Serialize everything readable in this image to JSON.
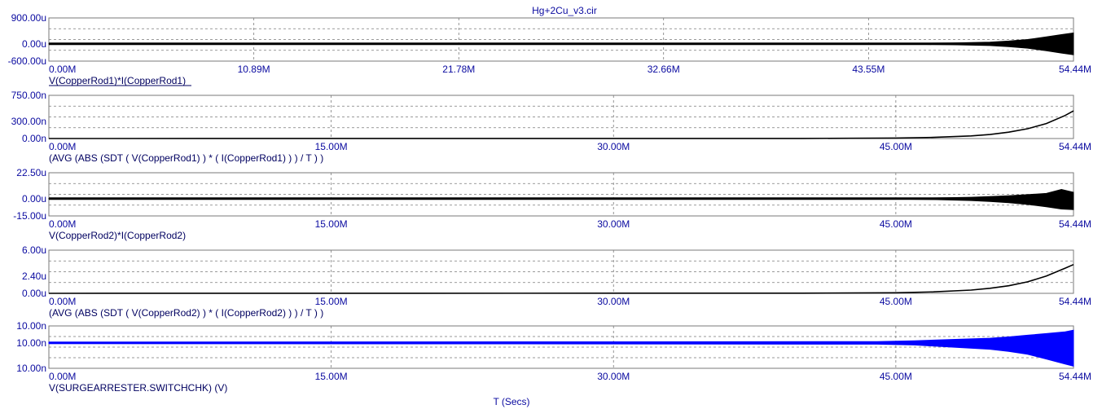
{
  "window": {
    "title": "Hg+2Cu_v3.cir"
  },
  "xaxis": {
    "label": "T (Secs)"
  },
  "colors": {
    "text": "#0a0aa0",
    "grid": "#7a7a7a",
    "frame": "#7a7a7a",
    "trace": "#000000",
    "trace_blue": "#0000ff"
  },
  "chart_data": [
    {
      "type": "line",
      "trace": "V(CopperRod1)*I(CopperRod1)",
      "xlim": [
        0,
        54.44
      ],
      "x_unit": "M",
      "xticks": [
        "0.00M",
        "10.89M",
        "21.78M",
        "32.66M",
        "43.55M",
        "54.44M"
      ],
      "ylim": [
        -600,
        900
      ],
      "y_unit": "u",
      "yticks": [
        "900.00u",
        "0.00u",
        "-600.00u"
      ],
      "ytick_values": [
        900,
        0,
        -600
      ],
      "color": "#000000",
      "series": [
        {
          "style": "oscillating-envelope",
          "x": [
            0,
            43.55,
            46,
            48,
            50,
            51,
            52,
            53,
            53.8,
            54.44
          ],
          "upper": [
            3,
            6,
            14,
            30,
            60,
            95,
            150,
            240,
            320,
            380
          ],
          "lower": [
            -3,
            -6,
            -14,
            -30,
            -60,
            -95,
            -150,
            -240,
            -320,
            -380
          ]
        }
      ]
    },
    {
      "type": "line",
      "trace": "(AVG (ABS (SDT ( V(CopperRod1) ) * ( I(CopperRod1) ) ) / T ) )",
      "xlim": [
        0,
        54.44
      ],
      "x_unit": "M",
      "xticks": [
        "0.00M",
        "15.00M",
        "30.00M",
        "45.00M",
        "54.44M"
      ],
      "ylim": [
        0,
        750
      ],
      "y_unit": "n",
      "yticks": [
        "750.00n",
        "300.00n",
        "0.00n"
      ],
      "ytick_values": [
        750,
        300,
        0
      ],
      "color": "#000000",
      "series": [
        {
          "style": "line",
          "x": [
            0,
            40,
            45,
            47,
            49,
            50,
            51,
            52,
            53,
            54,
            54.44
          ],
          "y": [
            0,
            2,
            8,
            20,
            45,
            70,
            110,
            170,
            260,
            400,
            480
          ]
        }
      ]
    },
    {
      "type": "line",
      "trace": "V(CopperRod2)*I(CopperRod2)",
      "xlim": [
        0,
        54.44
      ],
      "x_unit": "M",
      "xticks": [
        "0.00M",
        "15.00M",
        "30.00M",
        "45.00M",
        "54.44M"
      ],
      "ylim": [
        -15,
        22.5
      ],
      "y_unit": "u",
      "yticks": [
        "22.50u",
        "0.00u",
        "-15.00u"
      ],
      "ytick_values": [
        22.5,
        0,
        -15
      ],
      "color": "#000000",
      "series": [
        {
          "style": "oscillating-envelope",
          "x": [
            0,
            45,
            47,
            49,
            50,
            51,
            52,
            53,
            53.8,
            54.44
          ],
          "upper": [
            0.15,
            0.3,
            0.6,
            1.2,
            1.8,
            2.5,
            3.5,
            4.5,
            8,
            5.5
          ],
          "lower": [
            -0.15,
            -0.3,
            -0.8,
            -1.6,
            -2.5,
            -3.5,
            -5,
            -7,
            -9,
            -9.5
          ]
        }
      ]
    },
    {
      "type": "line",
      "trace": "(AVG (ABS (SDT ( V(CopperRod2) ) * ( I(CopperRod2) ) ) / T ) )",
      "xlim": [
        0,
        54.44
      ],
      "x_unit": "M",
      "xticks": [
        "0.00M",
        "15.00M",
        "30.00M",
        "45.00M",
        "54.44M"
      ],
      "ylim": [
        0,
        6
      ],
      "y_unit": "u",
      "yticks": [
        "6.00u",
        "2.40u",
        "0.00u"
      ],
      "ytick_values": [
        6,
        2.4,
        0
      ],
      "color": "#000000",
      "series": [
        {
          "style": "line",
          "x": [
            0,
            40,
            45,
            47,
            49,
            50,
            51,
            52,
            53,
            54,
            54.44
          ],
          "y": [
            0,
            0.02,
            0.08,
            0.2,
            0.45,
            0.7,
            1.05,
            1.6,
            2.4,
            3.5,
            4.0
          ]
        }
      ]
    },
    {
      "type": "line",
      "trace": "V(SURGEARRESTER.SWITCHCHK) (V)",
      "xlim": [
        0,
        54.44
      ],
      "x_unit": "M",
      "xticks": [
        "0.00M",
        "15.00M",
        "30.00M",
        "45.00M",
        "54.44M"
      ],
      "ylim": [
        0,
        1
      ],
      "yticks": [
        "10.00n",
        "10.00n",
        "10.00n"
      ],
      "ytick_values": [
        1,
        0.6,
        0
      ],
      "color": "#0000ff",
      "series": [
        {
          "style": "oscillating-envelope",
          "x": [
            0,
            44,
            46,
            48,
            50,
            51,
            52,
            53,
            54,
            54.44
          ],
          "upper": [
            0.615,
            0.63,
            0.65,
            0.68,
            0.71,
            0.74,
            0.78,
            0.82,
            0.86,
            0.9
          ],
          "lower": [
            0.585,
            0.57,
            0.55,
            0.5,
            0.45,
            0.4,
            0.33,
            0.22,
            0.1,
            0.05
          ]
        }
      ]
    }
  ]
}
